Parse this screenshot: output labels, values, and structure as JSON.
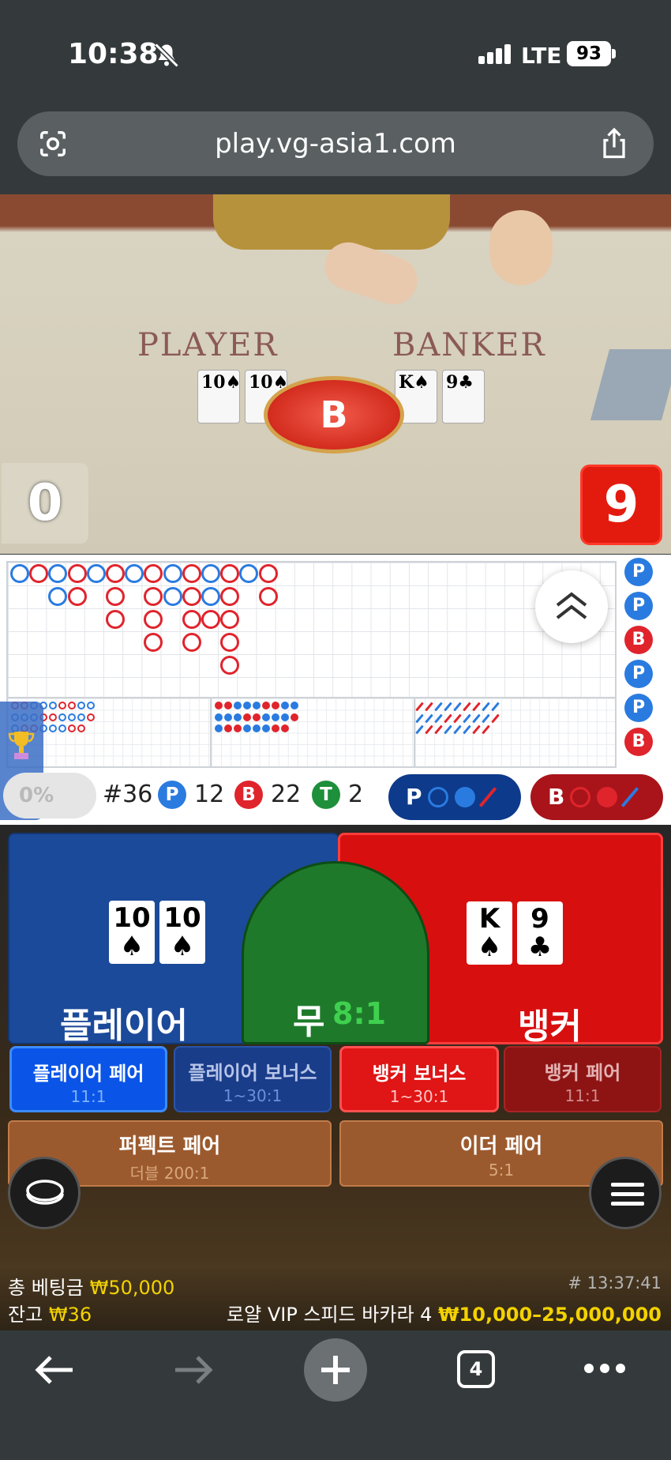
{
  "status_bar": {
    "time": "10:38",
    "network": "LTE",
    "battery": "93"
  },
  "browser": {
    "url": "play.vg-asia1.com",
    "tab_count": "4"
  },
  "video": {
    "player_label": "PLAYER",
    "banker_label": "BANKER",
    "winner_badge": "B",
    "player_score": "0",
    "banker_score": "9",
    "player_cards": [
      "10♠",
      "10♠"
    ],
    "banker_cards": [
      "K♠",
      "9♣"
    ]
  },
  "roadmap": {
    "bead_side": [
      {
        "label": "P",
        "color": "#2a7be0"
      },
      {
        "label": "P",
        "color": "#2a7be0"
      },
      {
        "label": "B",
        "color": "#e0242c"
      },
      {
        "label": "P",
        "color": "#2a7be0"
      },
      {
        "label": "P",
        "color": "#2a7be0"
      },
      {
        "label": "B",
        "color": "#e0242c"
      }
    ],
    "percent": "0%",
    "round": "#36",
    "player_badge": "P",
    "player_count": "12",
    "banker_badge": "B",
    "banker_count": "22",
    "tie_badge": "T",
    "tie_count": "2",
    "player_ask": "P",
    "banker_ask": "B"
  },
  "colors": {
    "player": "#1c4a9a",
    "banker": "#d80f0f",
    "tie": "#1e7a2a",
    "accent_yellow": "#f3d200"
  },
  "betting": {
    "player": {
      "label": "플레이어",
      "cards": [
        {
          "rank": "10",
          "suit": "♠"
        },
        {
          "rank": "10",
          "suit": "♠"
        }
      ]
    },
    "tie": {
      "label": "무",
      "odds": "8:1"
    },
    "banker": {
      "label": "뱅커",
      "cards": [
        {
          "rank": "K",
          "suit": "♠"
        },
        {
          "rank": "9",
          "suit": "♣"
        }
      ]
    },
    "side_bets": [
      {
        "label": "플레이어 페어",
        "odds": "11:1"
      },
      {
        "label": "플레이어 보너스",
        "odds": "1~30:1"
      },
      {
        "label": "뱅커 보너스",
        "odds": "1~30:1"
      },
      {
        "label": "뱅커 페어",
        "odds": "11:1"
      }
    ],
    "pair_bets": [
      {
        "label": "퍼펙트 페어",
        "odds": "더블 200:1"
      },
      {
        "label": "이더 페어",
        "odds": "5:1"
      }
    ]
  },
  "footer_info": {
    "total_bet_label": "총 베팅금",
    "total_bet_value": "₩50,000",
    "balance_label": "잔고",
    "balance_value": "₩36",
    "game_id": "# 13:37:41",
    "table_name": "로얄 VIP 스피드 바카라 4",
    "limits": "₩10,000–25,000,000"
  }
}
